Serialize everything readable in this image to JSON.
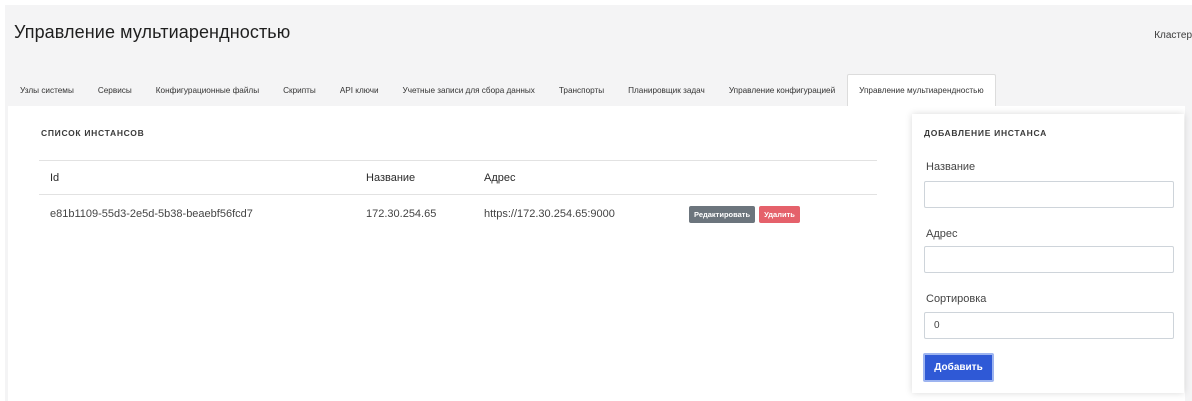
{
  "header": {
    "title": "Управление мультиарендностью",
    "cluster_link": "Кластер"
  },
  "tabs": [
    {
      "label": "Узлы системы"
    },
    {
      "label": "Сервисы"
    },
    {
      "label": "Конфигурационные файлы"
    },
    {
      "label": "Скрипты"
    },
    {
      "label": "API ключи"
    },
    {
      "label": "Учетные записи для сбора данных"
    },
    {
      "label": "Транспорты"
    },
    {
      "label": "Планировщик задач"
    },
    {
      "label": "Управление конфигурацией"
    },
    {
      "label": "Управление мультиарендностью",
      "active": true
    }
  ],
  "instances": {
    "title": "СПИСОК ИНСТАНСОВ",
    "columns": [
      "Id",
      "Название",
      "Адрес"
    ],
    "rows": [
      {
        "id": "e81b1109-55d3-2e5d-5b38-beaebf56fcd7",
        "name": "172.30.254.65",
        "address": "https://172.30.254.65:9000",
        "edit_label": "Редактировать",
        "delete_label": "Удалить"
      }
    ]
  },
  "add_form": {
    "title": "ДОБАВЛЕНИЕ ИНСТАНСА",
    "name_label": "Название",
    "name_value": "",
    "address_label": "Адрес",
    "address_value": "",
    "sort_label": "Сортировка",
    "sort_value": "0",
    "submit_label": "Добавить"
  },
  "colors": {
    "primary": "#2f59d6",
    "danger": "#e5616b",
    "secondary": "#6c757d"
  }
}
